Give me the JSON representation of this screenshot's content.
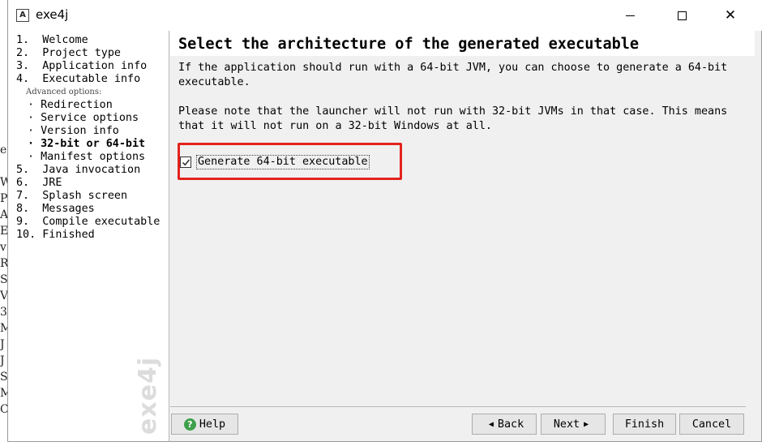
{
  "window": {
    "title": "exe4j",
    "icon_letter": "A",
    "controls": {
      "minimize": "minimize-icon",
      "maximize": "maximize-icon",
      "close": "✕"
    }
  },
  "sidebar": {
    "steps": [
      {
        "label": "1.  Welcome",
        "bold": false,
        "sub": false
      },
      {
        "label": "2.  Project type",
        "bold": false,
        "sub": false
      },
      {
        "label": "3.  Application info",
        "bold": false,
        "sub": false
      },
      {
        "label": "4.  Executable info",
        "bold": false,
        "sub": false
      },
      {
        "label": "Advanced options:",
        "kind": "advanced-label"
      },
      {
        "label": "· Redirection",
        "bold": false,
        "sub": true
      },
      {
        "label": "· Service options",
        "bold": false,
        "sub": true
      },
      {
        "label": "· Version info",
        "bold": false,
        "sub": true
      },
      {
        "label": "· 32-bit or 64-bit",
        "bold": true,
        "sub": true
      },
      {
        "label": "· Manifest options",
        "bold": false,
        "sub": true
      },
      {
        "label": "5.  Java invocation",
        "bold": false,
        "sub": false
      },
      {
        "label": "6.  JRE",
        "bold": false,
        "sub": false
      },
      {
        "label": "7.  Splash screen",
        "bold": false,
        "sub": false
      },
      {
        "label": "8.  Messages",
        "bold": false,
        "sub": false
      },
      {
        "label": "9.  Compile executable",
        "bold": false,
        "sub": false
      },
      {
        "label": "10. Finished",
        "bold": false,
        "sub": false
      }
    ],
    "logo_text": "exe4j"
  },
  "main": {
    "title": "Select the architecture of the generated executable",
    "paragraph1": "If the application should run with a 64-bit JVM, you can choose to generate a 64-bit\nexecutable.",
    "paragraph2": "Please note that the launcher will not run with 32-bit JVMs in that case. This means\nthat it will not run on a 32-bit Windows at all.",
    "checkbox": {
      "label": "Generate 64-bit executable",
      "checked": true
    },
    "highlight_color": "#e3221e"
  },
  "buttons": {
    "help": "Help",
    "back": "Back",
    "next": "Next",
    "finish": "Finish",
    "cancel": "Cancel"
  },
  "background_window": {
    "letters": [
      "e",
      "",
      "W",
      "P",
      "A",
      "E",
      "v",
      "R",
      "S",
      "V",
      "3",
      "M",
      "J",
      "J",
      "S",
      "M",
      "C"
    ]
  }
}
